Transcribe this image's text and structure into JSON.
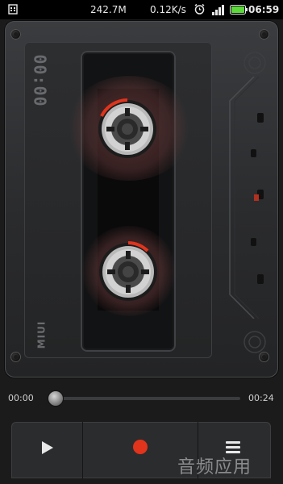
{
  "status_bar": {
    "left_icon": "sim-card-icon",
    "storage": "242.7M",
    "speed": "0.12K/s",
    "alarm_icon": "alarm-clock-icon",
    "signal_icon": "signal-bars-icon",
    "battery_icon": "battery-icon",
    "time": "06:59"
  },
  "recorder": {
    "counter": "00:00",
    "brand": "MIUI"
  },
  "playback": {
    "elapsed": "00:00",
    "total": "00:24",
    "progress": 0
  },
  "controls": {
    "play_icon": "play-icon",
    "record_icon": "record-icon",
    "menu_icon": "menu-icon"
  },
  "overlay": {
    "watermark": "音频应用"
  },
  "colors": {
    "record_red": "#e0341c",
    "reel_glow": "#8c5050"
  }
}
